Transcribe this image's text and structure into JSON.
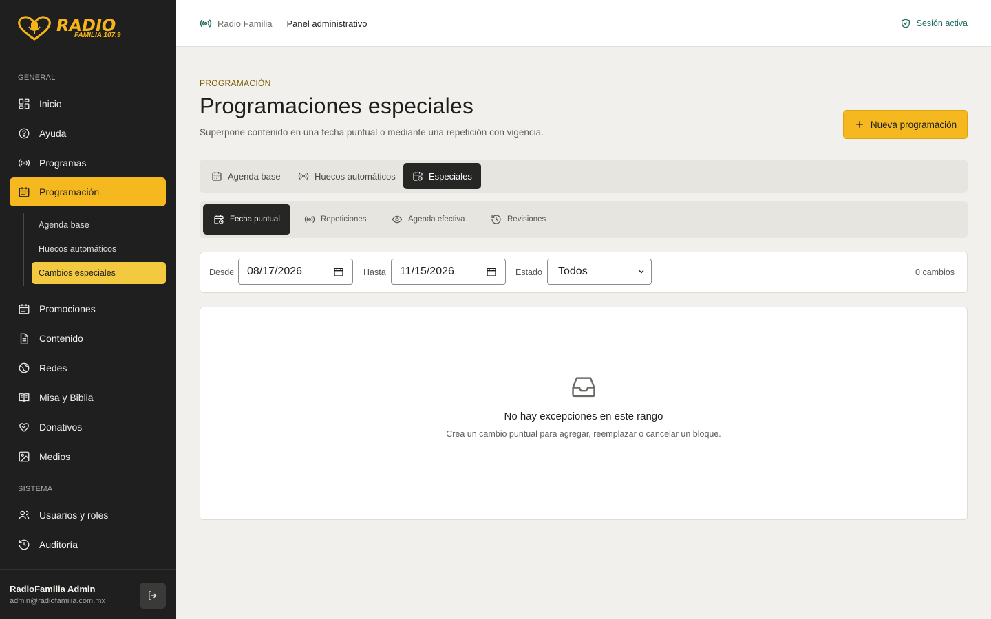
{
  "brand": {
    "name": "RADIO",
    "sub": "FAMILIA",
    "freq": "107.9",
    "accent": "#f5b91f",
    "sidebar_bg": "#1f1f1f"
  },
  "sidebar": {
    "section_general": "GENERAL",
    "section_system": "SISTEMA",
    "items": [
      {
        "label": "Inicio",
        "icon": "grid-icon"
      },
      {
        "label": "Ayuda",
        "icon": "help-circle-icon"
      },
      {
        "label": "Programas",
        "icon": "broadcast-icon"
      },
      {
        "label": "Programación",
        "icon": "calendar-icon",
        "active": true
      },
      {
        "label": "Promociones",
        "icon": "calendar-icon"
      },
      {
        "label": "Contenido",
        "icon": "document-icon"
      },
      {
        "label": "Redes",
        "icon": "globe-icon"
      },
      {
        "label": "Misa y Biblia",
        "icon": "book-icon"
      },
      {
        "label": "Donativos",
        "icon": "heart-hand-icon"
      },
      {
        "label": "Medios",
        "icon": "image-icon"
      },
      {
        "label": "Usuarios y roles",
        "icon": "users-icon"
      },
      {
        "label": "Auditoría",
        "icon": "history-icon"
      }
    ],
    "subitems": [
      {
        "label": "Agenda base"
      },
      {
        "label": "Huecos automáticos"
      },
      {
        "label": "Cambios especiales",
        "active": true
      }
    ]
  },
  "user": {
    "name": "RadioFamilia Admin",
    "email": "admin@radiofamilia.com.mx"
  },
  "topbar": {
    "home": "Radio Familia",
    "current": "Panel administrativo",
    "session": "Sesión activa"
  },
  "page": {
    "eyebrow": "PROGRAMACIÓN",
    "title": "Programaciones especiales",
    "subtitle": "Superpone contenido en una fecha puntual o mediante una repetición con vigencia.",
    "new_button": "Nueva programación"
  },
  "tabs": [
    {
      "label": "Agenda base",
      "icon": "calendar-icon"
    },
    {
      "label": "Huecos automáticos",
      "icon": "broadcast-icon"
    },
    {
      "label": "Especiales",
      "icon": "calendar-clock-icon",
      "active": true
    }
  ],
  "subtabs": [
    {
      "label": "Fecha puntual",
      "icon": "calendar-clock-icon",
      "active": true
    },
    {
      "label": "Repeticiones",
      "icon": "broadcast-icon"
    },
    {
      "label": "Agenda efectiva",
      "icon": "eye-icon"
    },
    {
      "label": "Revisiones",
      "icon": "history-icon"
    }
  ],
  "filters": {
    "from_label": "Desde",
    "from_value": "08/17/2026",
    "to_label": "Hasta",
    "to_value": "11/15/2026",
    "status_label": "Estado",
    "status_value": "Todos",
    "count": "0 cambios"
  },
  "empty": {
    "title": "No hay excepciones en este rango",
    "description": "Crea un cambio puntual para agregar, reemplazar o cancelar un bloque."
  }
}
